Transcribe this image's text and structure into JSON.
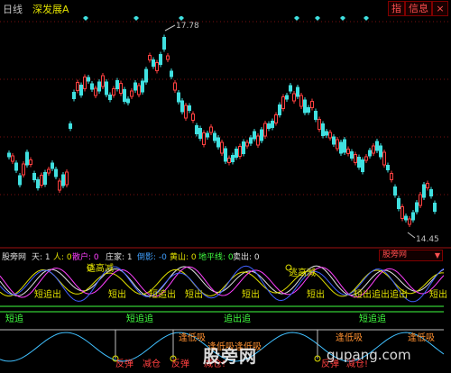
{
  "header": {
    "period": "日线",
    "stock": "深发展A",
    "buttons": {
      "zhi": "指",
      "xinxi": "信息",
      "close": "×"
    }
  },
  "price_chart": {
    "high_label": "17.78",
    "low_label": "14.45",
    "colors": {
      "up": "#ff4040",
      "down": "#40e0e0",
      "diamond": "#40e0e0",
      "grid": "#7a1010"
    }
  },
  "indicator_bar": {
    "name": "股旁网",
    "items": [
      {
        "text": "天: 1",
        "color": "#e0e0e0"
      },
      {
        "text": "人: 0",
        "color": "#e0e000"
      },
      {
        "text": "散户: 0",
        "color": "#ff40ff"
      },
      {
        "text": "庄家: 1",
        "color": "#e0e0e0"
      },
      {
        "text": "倒影: -0",
        "color": "#40a0ff"
      },
      {
        "text": "黄山: 0",
        "color": "#e0e000"
      },
      {
        "text": "地平线: 0",
        "color": "#40ff40"
      },
      {
        "text": "卖出: 0",
        "color": "#e0e0e0"
      }
    ],
    "selector": "股旁网"
  },
  "indicator_labels": {
    "top": [
      "逃高减",
      "逃高减"
    ],
    "short": [
      "短追出",
      "短出",
      "短追出",
      "短出",
      "短出",
      "短出",
      "短出追出",
      "追出",
      "短出"
    ],
    "bands": [
      "短追",
      "短追追",
      "追出追",
      "短追追"
    ],
    "low": [
      "逢低吸",
      "逢低吸逢低吸",
      "逢低吸",
      "逢低吸"
    ],
    "bottom": [
      "反弹",
      "减仓",
      "反弹",
      "减仓!",
      "反弹",
      "减仓!"
    ]
  },
  "watermark": {
    "label": "股旁网",
    "url": "gupang.com"
  }
}
